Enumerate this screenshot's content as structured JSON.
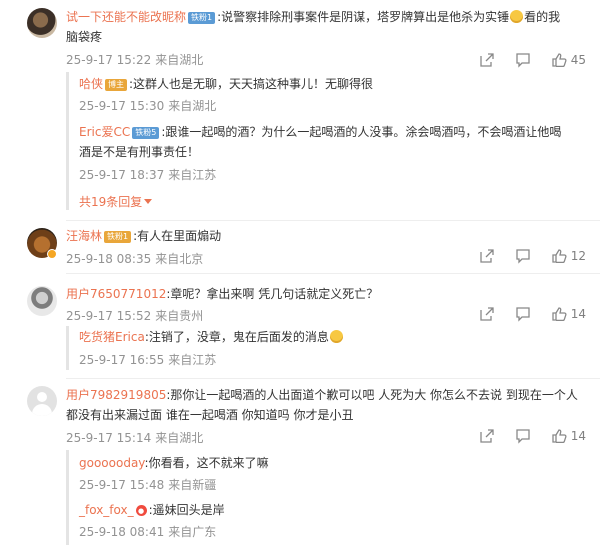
{
  "comments": [
    {
      "author": "试一下还能不能改昵称",
      "badge": "铁粉1",
      "text_line1": ":说警察排除刑事案件是阴谋，塔罗牌算出是他杀为实锤",
      "text_line1_end": "看的我",
      "text_line2": "脑袋疼",
      "date": "25-9-17 15:22",
      "location": "来自湖北",
      "likes": "45",
      "replies": [
        {
          "author": "哈侠",
          "badge": "博主",
          "text": ":这群人也是无聊，天天搞这种事儿！无聊得很",
          "date": "25-9-17 15:30",
          "location": "来自湖北"
        },
        {
          "author": "Eric爱CC",
          "badge": "铁粉5",
          "text_line1": ":跟谁一起喝的酒？为什么一起喝酒的人没事。涂会喝酒吗，不会喝酒让他喝",
          "text_line2": "酒是不是有刑事责任！",
          "date": "25-9-17 18:37",
          "location": "来自江苏"
        }
      ],
      "more_replies": "共19条回复"
    },
    {
      "author": "汪海林",
      "badge": "铁粉1",
      "text": ":有人在里面煽动",
      "date": "25-9-18 08:35",
      "location": "来自北京",
      "likes": "12"
    },
    {
      "author": "用户7650771012",
      "text": ":章呢？拿出来啊 凭几句话就定义死亡？",
      "date": "25-9-17 15:52",
      "location": "来自贵州",
      "likes": "14",
      "replies": [
        {
          "author": "吃货猪Erica",
          "text": ":注销了，没章，鬼在后面发的消息",
          "date": "25-9-17 16:55",
          "location": "来自江苏"
        }
      ]
    },
    {
      "author": "用户7982919805",
      "text_line1": ":那你让一起喝酒的人出面道个歉可以吧 人死为大 你怎么不去说 到现在一个人",
      "text_line2": "都没有出来漏过面 谁在一起喝酒 你知道吗 你才是小丑",
      "date": "25-9-17 15:14",
      "location": "来自湖北",
      "likes": "14",
      "replies": [
        {
          "author": "goooooday",
          "text": ":你看看，这不就来了嘛",
          "date": "25-9-17 15:48",
          "location": "来自新疆"
        },
        {
          "author": "_fox_fox_",
          "text": ":遥妹回头是岸",
          "date": "25-9-18 08:41",
          "location": "来自广东"
        }
      ]
    }
  ]
}
